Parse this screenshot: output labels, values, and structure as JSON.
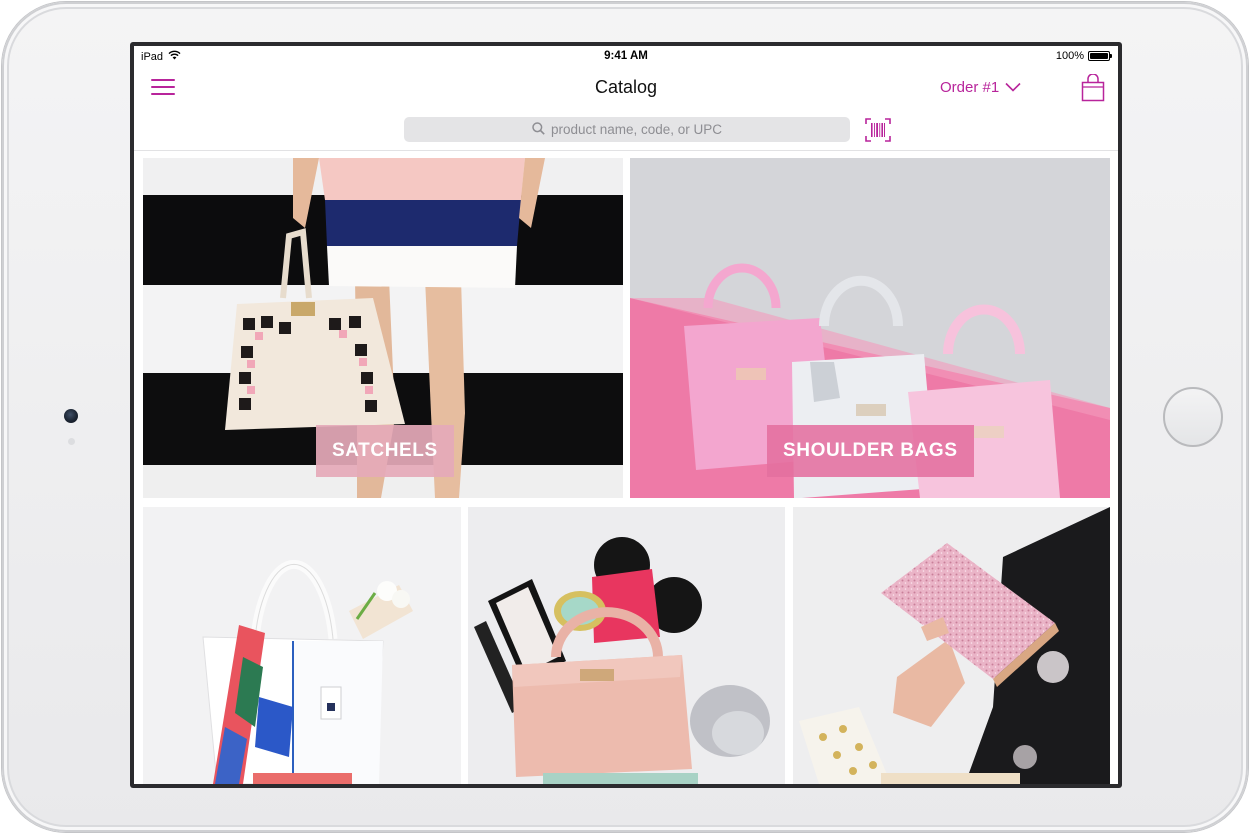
{
  "device": {
    "model": "iPad"
  },
  "status_bar": {
    "carrier": "iPad",
    "time": "9:41 AM",
    "battery": "100%"
  },
  "nav": {
    "title": "Catalog",
    "order_label": "Order #1"
  },
  "search": {
    "placeholder": "product name, code, or UPC"
  },
  "categories": [
    {
      "label": "SATCHELS"
    },
    {
      "label": "SHOULDER BAGS"
    },
    {
      "label": ""
    },
    {
      "label": ""
    },
    {
      "label": ""
    }
  ],
  "colors": {
    "accent": "#b8249b",
    "satchels_label_bg": "#e5a9b8",
    "shoulder_label_bg": "#e4709f",
    "totes_label_bg": "#ea6d6b",
    "crossbody_label_bg": "#a8d2c5",
    "wallets_label_bg": "#efdfc6"
  },
  "icons": [
    "hamburger-menu-icon",
    "chevron-down-icon",
    "shopping-bag-icon",
    "magnifying-glass-icon",
    "barcode-scanner-icon",
    "wifi-icon",
    "battery-icon"
  ]
}
